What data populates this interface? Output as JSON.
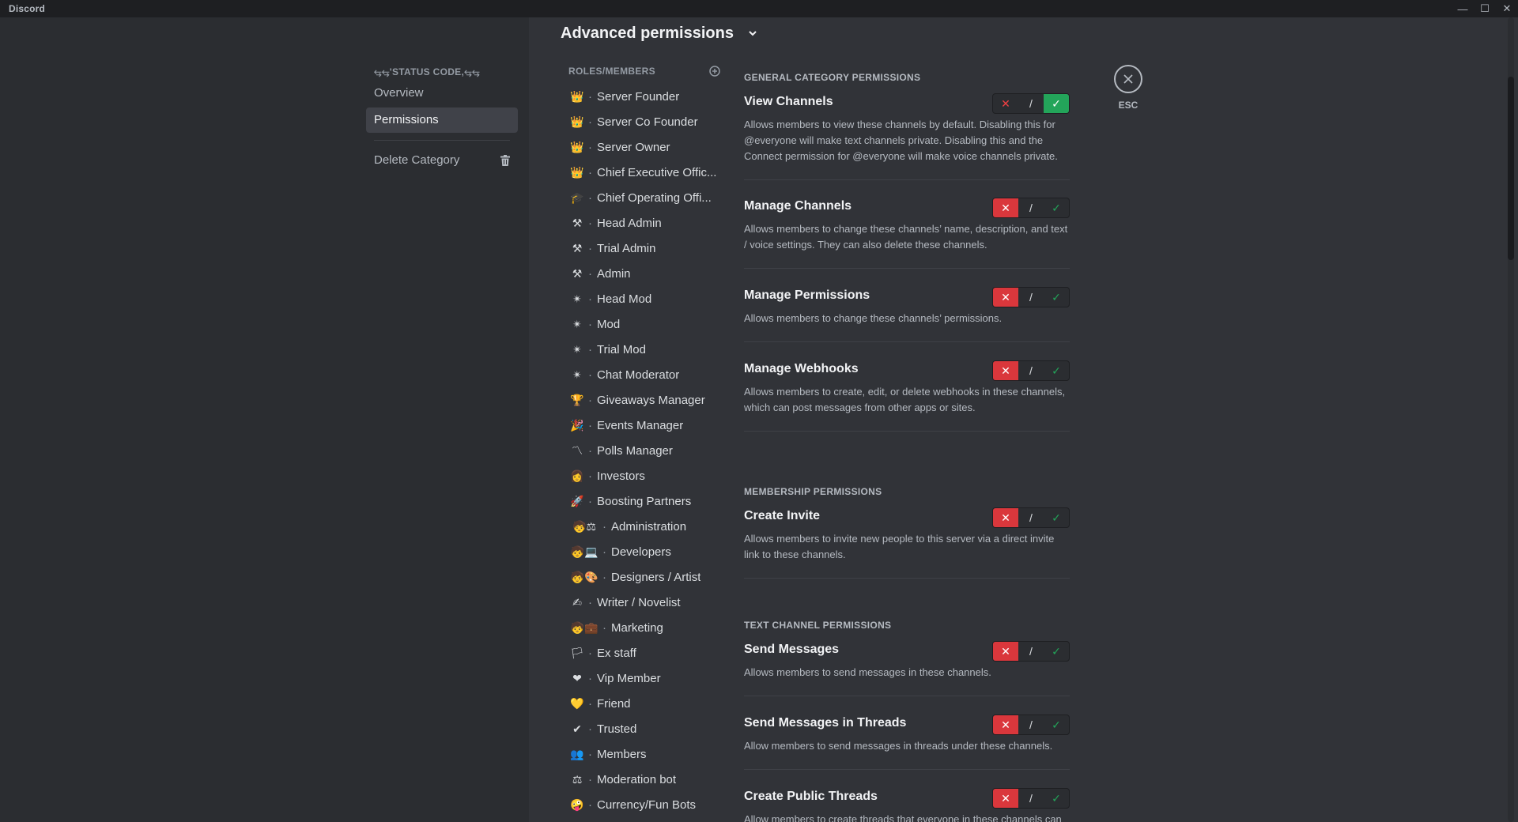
{
  "window": {
    "app_name": "Discord",
    "minimize": "—",
    "maximize": "☐",
    "close": "✕"
  },
  "sidebar": {
    "header": "⥃⥃'STATUS CODE,⥃⥃",
    "items": [
      {
        "label": "Overview"
      },
      {
        "label": "Permissions"
      }
    ],
    "delete_label": "Delete Category"
  },
  "page": {
    "title": "Advanced permissions"
  },
  "roles": {
    "header": "ROLES/MEMBERS",
    "list": [
      {
        "emoji": "👑",
        "name": "Server Founder"
      },
      {
        "emoji": "👑",
        "name": "Server Co Founder"
      },
      {
        "emoji": "👑",
        "name": "Server Owner"
      },
      {
        "emoji": "👑",
        "name": "Chief Executive Offic..."
      },
      {
        "emoji": "🎓",
        "name": "Chief Operating Offi..."
      },
      {
        "emoji": "⚒",
        "name": "Head Admin"
      },
      {
        "emoji": "⚒",
        "name": "Trial Admin"
      },
      {
        "emoji": "⚒",
        "name": "Admin"
      },
      {
        "emoji": "✴",
        "name": "Head Mod"
      },
      {
        "emoji": "✴",
        "name": "Mod"
      },
      {
        "emoji": "✴",
        "name": "Trial Mod"
      },
      {
        "emoji": "✴",
        "name": "Chat Moderator"
      },
      {
        "emoji": "🏆",
        "name": "Giveaways Manager"
      },
      {
        "emoji": "🎉",
        "name": "Events Manager"
      },
      {
        "emoji": "〽",
        "name": "Polls Manager"
      },
      {
        "emoji": "👩",
        "name": "Investors"
      },
      {
        "emoji": "🚀",
        "name": "Boosting Partners"
      },
      {
        "emoji": "🧒⚖",
        "name": "Administration"
      },
      {
        "emoji": "🧒💻",
        "name": "Developers"
      },
      {
        "emoji": "🧒🎨",
        "name": "Designers / Artist"
      },
      {
        "emoji": "✍",
        "name": "Writer / Novelist"
      },
      {
        "emoji": "🧒💼",
        "name": "Marketing"
      },
      {
        "emoji": "🏳",
        "name": "Ex staff"
      },
      {
        "emoji": "❤",
        "name": "Vip Member"
      },
      {
        "emoji": "💛",
        "name": "Friend"
      },
      {
        "emoji": "✔",
        "name": "Trusted"
      },
      {
        "emoji": "👥",
        "name": "Members"
      },
      {
        "emoji": "⚖",
        "name": "Moderation bot"
      },
      {
        "emoji": "🤪",
        "name": "Currency/Fun Bots"
      }
    ]
  },
  "permissions": {
    "toggle_labels": {
      "deny": "✕",
      "neutral": "/",
      "allow": "✓"
    },
    "sections": [
      {
        "header": "GENERAL CATEGORY PERMISSIONS",
        "items": [
          {
            "name": "View Channels",
            "state": "allow",
            "desc": "Allows members to view these channels by default. Disabling this for @everyone will make text channels private. Disabling this and the Connect permission for @everyone will make voice channels private."
          },
          {
            "name": "Manage Channels",
            "state": "deny",
            "desc": "Allows members to change these channels’ name, description, and text / voice settings. They can also delete these channels."
          },
          {
            "name": "Manage Permissions",
            "state": "deny",
            "desc": "Allows members to change these channels’ permissions."
          },
          {
            "name": "Manage Webhooks",
            "state": "deny",
            "desc": "Allows members to create, edit, or delete webhooks in these channels, which can post messages from other apps or sites."
          }
        ]
      },
      {
        "header": "MEMBERSHIP PERMISSIONS",
        "items": [
          {
            "name": "Create Invite",
            "state": "deny",
            "desc": "Allows members to invite new people to this server via a direct invite link to these channels."
          }
        ]
      },
      {
        "header": "TEXT CHANNEL PERMISSIONS",
        "items": [
          {
            "name": "Send Messages",
            "state": "deny",
            "desc": "Allows members to send messages in these channels."
          },
          {
            "name": "Send Messages in Threads",
            "state": "deny",
            "desc": "Allow members to send messages in threads under these channels."
          },
          {
            "name": "Create Public Threads",
            "state": "deny",
            "desc": "Allow members to create threads that everyone in these channels can"
          }
        ]
      }
    ]
  },
  "close": {
    "label": "ESC"
  },
  "colors": {
    "bg": "#313338",
    "sidebar": "#2b2d31",
    "deny": "#da373c",
    "allow": "#23a55a"
  }
}
